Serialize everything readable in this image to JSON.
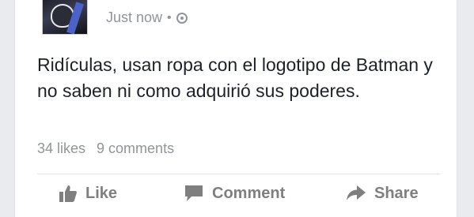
{
  "post": {
    "timestamp": "Just now",
    "separator": "•",
    "privacy_icon": "globe-icon",
    "text": "Ridículas, usan ropa con el logotipo de Batman y no saben ni como adquirió sus poderes.",
    "stats": {
      "likes": "34 likes",
      "comments": "9 comments"
    }
  },
  "actions": {
    "like_label": "Like",
    "comment_label": "Comment",
    "share_label": "Share"
  },
  "colors": {
    "text": "#1d2129",
    "meta": "#90949c",
    "action": "#7f7f7f"
  }
}
